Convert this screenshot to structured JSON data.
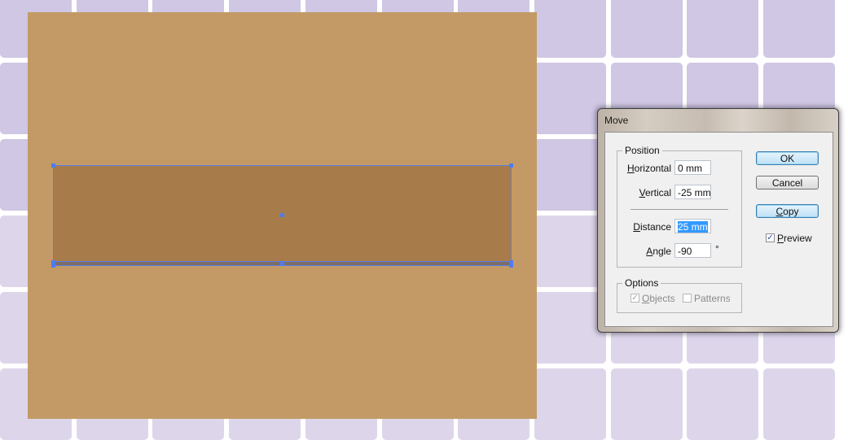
{
  "background": {
    "tile_color_top": "#CFC7E3",
    "tile_color_bottom": "#DDD6EB"
  },
  "artboard": {
    "fill": "#C39A66",
    "rect_fill": "#A87C4A",
    "selection_color": "#4F7CF0"
  },
  "dialog": {
    "title": "Move",
    "position_group": {
      "label": "Position",
      "horizontal": {
        "label": "Horizontal",
        "value": "0 mm"
      },
      "vertical": {
        "label": "Vertical",
        "value": "-25 mm"
      },
      "distance": {
        "label": "Distance",
        "value": "25 mm"
      },
      "angle": {
        "label": "Angle",
        "value": "-90",
        "unit": "°"
      }
    },
    "options_group": {
      "label": "Options",
      "objects": {
        "label": "Objects",
        "checked": true,
        "enabled": false
      },
      "patterns": {
        "label": "Patterns",
        "checked": false,
        "enabled": false
      }
    },
    "buttons": {
      "ok": "OK",
      "cancel": "Cancel",
      "copy": "Copy"
    },
    "preview": {
      "label": "Preview",
      "checked": true
    }
  }
}
